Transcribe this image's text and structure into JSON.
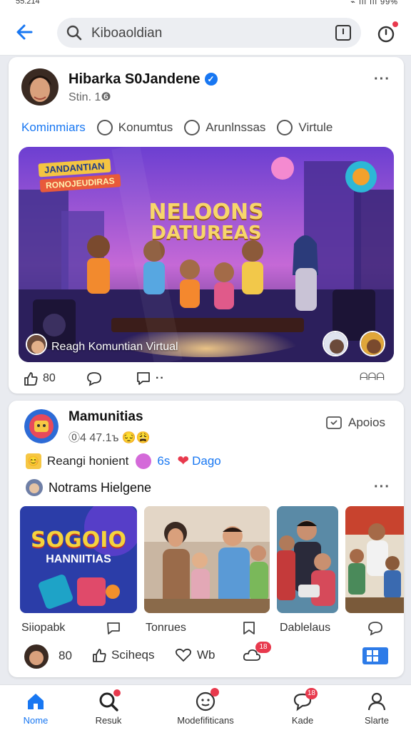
{
  "status": {
    "time": "55.214",
    "icons": "⌁ ıll ıll 99%"
  },
  "topbar": {
    "search_placeholder": "Kiboaoldian"
  },
  "post1": {
    "author": "Hibarka S0Jandene",
    "meta": "Stin. 1❻",
    "tabs": [
      "Kominmiars",
      "Konumtus",
      "Arunlnssas",
      "Virtule"
    ],
    "hero_banner_1": "JANDANTIAN",
    "hero_banner_2": "RONOJEUDIRAS",
    "hero_title_1": "NELOONS",
    "hero_title_2": "DATUREAS",
    "hero_caption": "Reagh Komuntian Virtual",
    "likes": "80",
    "share_label": "ᗩᗩᗩ"
  },
  "post2": {
    "author": "Mamunitias",
    "meta": "⓪4 47.1ъ 😔😩",
    "follow_label": "Apoios",
    "reactions_text": "Reangi honient",
    "reactions_count": "6s",
    "reactions_heart_label": "Dago",
    "subheader": "Notrams Hielgene",
    "thumb1_title_1": "SOGOIO",
    "thumb1_title_2": "HANNIITIAS",
    "thumb_labels": [
      "Siiopabk",
      "Tonrues",
      "Dablelaus"
    ],
    "bottom_count": "80",
    "bottom_like": "Sciheqs",
    "bottom_comment": "Wb",
    "bottom_badge": "18"
  },
  "nav": {
    "items": [
      "Nome",
      "Resuk",
      "Modefifiticans",
      "Kade",
      "Slarte"
    ],
    "badges": {
      "notifications": "",
      "messages": "18"
    }
  },
  "colors": {
    "accent": "#1877f2",
    "badge": "#e8394d"
  }
}
